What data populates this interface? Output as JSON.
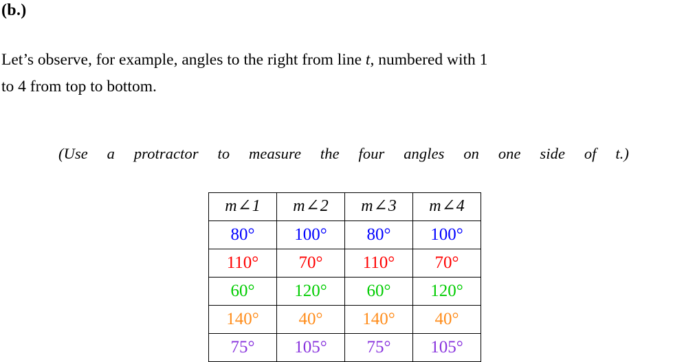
{
  "part": {
    "label": "(b.)"
  },
  "intro": {
    "line1_pre": "Let’s observe, for example, angles to the right from line ",
    "line1_var": "t",
    "line1_post": ", numbered with 1",
    "line2": "to 4 from top to bottom."
  },
  "note": {
    "text": "(Use a protractor to measure the four angles on one side of t.)"
  },
  "table": {
    "headers": [
      {
        "m": "m",
        "sym": "∠",
        "n": "1"
      },
      {
        "m": "m",
        "sym": "∠",
        "n": "2"
      },
      {
        "m": "m",
        "sym": "∠",
        "n": "3"
      },
      {
        "m": "m",
        "sym": "∠",
        "n": "4"
      }
    ],
    "rows": [
      {
        "color": "#0000FF",
        "values": [
          "80°",
          "100°",
          "80°",
          "100°"
        ]
      },
      {
        "color": "#FF0000",
        "values": [
          "110°",
          "70°",
          "110°",
          "70°"
        ]
      },
      {
        "color": "#00CC00",
        "values": [
          "60°",
          "120°",
          "60°",
          "120°"
        ]
      },
      {
        "color": "#FF8C1A",
        "values": [
          "140°",
          "40°",
          "140°",
          "40°"
        ]
      },
      {
        "color": "#8833DD",
        "values": [
          "75°",
          "105°",
          "75°",
          "105°"
        ]
      }
    ]
  },
  "chart_data": {
    "type": "table",
    "title": "",
    "columns": [
      "m∠1",
      "m∠2",
      "m∠3",
      "m∠4"
    ],
    "rows": [
      {
        "label": "row-1",
        "color": "#0000FF",
        "values": [
          80,
          100,
          80,
          100
        ]
      },
      {
        "label": "row-2",
        "color": "#FF0000",
        "values": [
          110,
          70,
          110,
          70
        ]
      },
      {
        "label": "row-3",
        "color": "#00CC00",
        "values": [
          60,
          120,
          60,
          120
        ]
      },
      {
        "label": "row-4",
        "color": "#FF8C1A",
        "values": [
          140,
          40,
          140,
          40
        ]
      },
      {
        "label": "row-5",
        "color": "#8833DD",
        "values": [
          75,
          105,
          75,
          105
        ]
      }
    ],
    "unit": "degrees"
  }
}
